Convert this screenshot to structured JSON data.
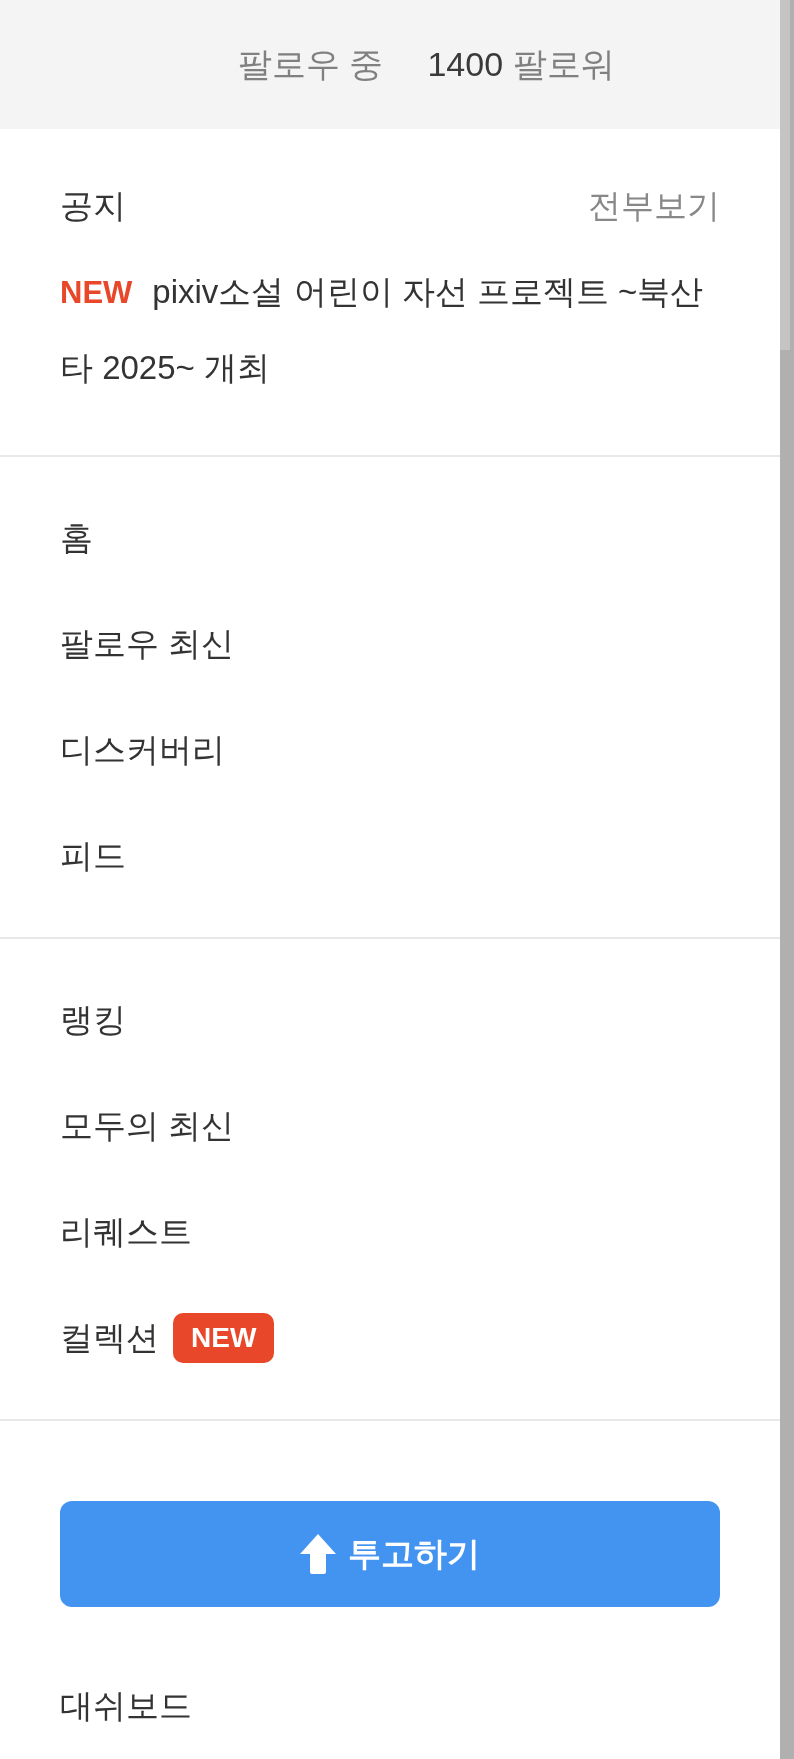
{
  "profile_stats": {
    "following_label": "팔로우 중",
    "followers_count": "1400",
    "followers_label": "팔로워"
  },
  "notice": {
    "title": "공지",
    "view_all": "전부보기",
    "items": [
      {
        "badge": "NEW",
        "text": "pixiv소설 어린이 자선 프로젝트 ~북산타 2025~ 개최"
      }
    ]
  },
  "menu_groups": [
    {
      "items": [
        {
          "label": "홈"
        },
        {
          "label": "팔로우 최신"
        },
        {
          "label": "디스커버리"
        },
        {
          "label": "피드"
        }
      ]
    },
    {
      "items": [
        {
          "label": "랭킹"
        },
        {
          "label": "모두의 최신"
        },
        {
          "label": "리퀘스트"
        },
        {
          "label": "컬렉션",
          "badge": "NEW"
        }
      ]
    }
  ],
  "upload_button": {
    "label": "투고하기"
  },
  "bottom_items": [
    {
      "label": "대쉬보드"
    }
  ]
}
